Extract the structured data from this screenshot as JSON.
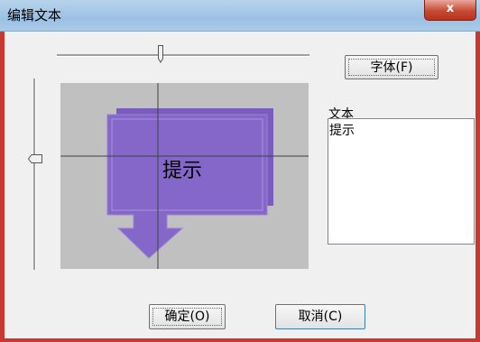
{
  "window": {
    "title": "编辑文本",
    "close_label": "x"
  },
  "toolbar": {
    "font_button": "字体(F)"
  },
  "preview": {
    "bubble_text": "提示",
    "bubble_color": "#8567c9",
    "background_color": "#c0c0c0"
  },
  "text_section": {
    "label": "文本",
    "value": "提示"
  },
  "buttons": {
    "ok": "确定(O)",
    "cancel": "取消(C)"
  }
}
